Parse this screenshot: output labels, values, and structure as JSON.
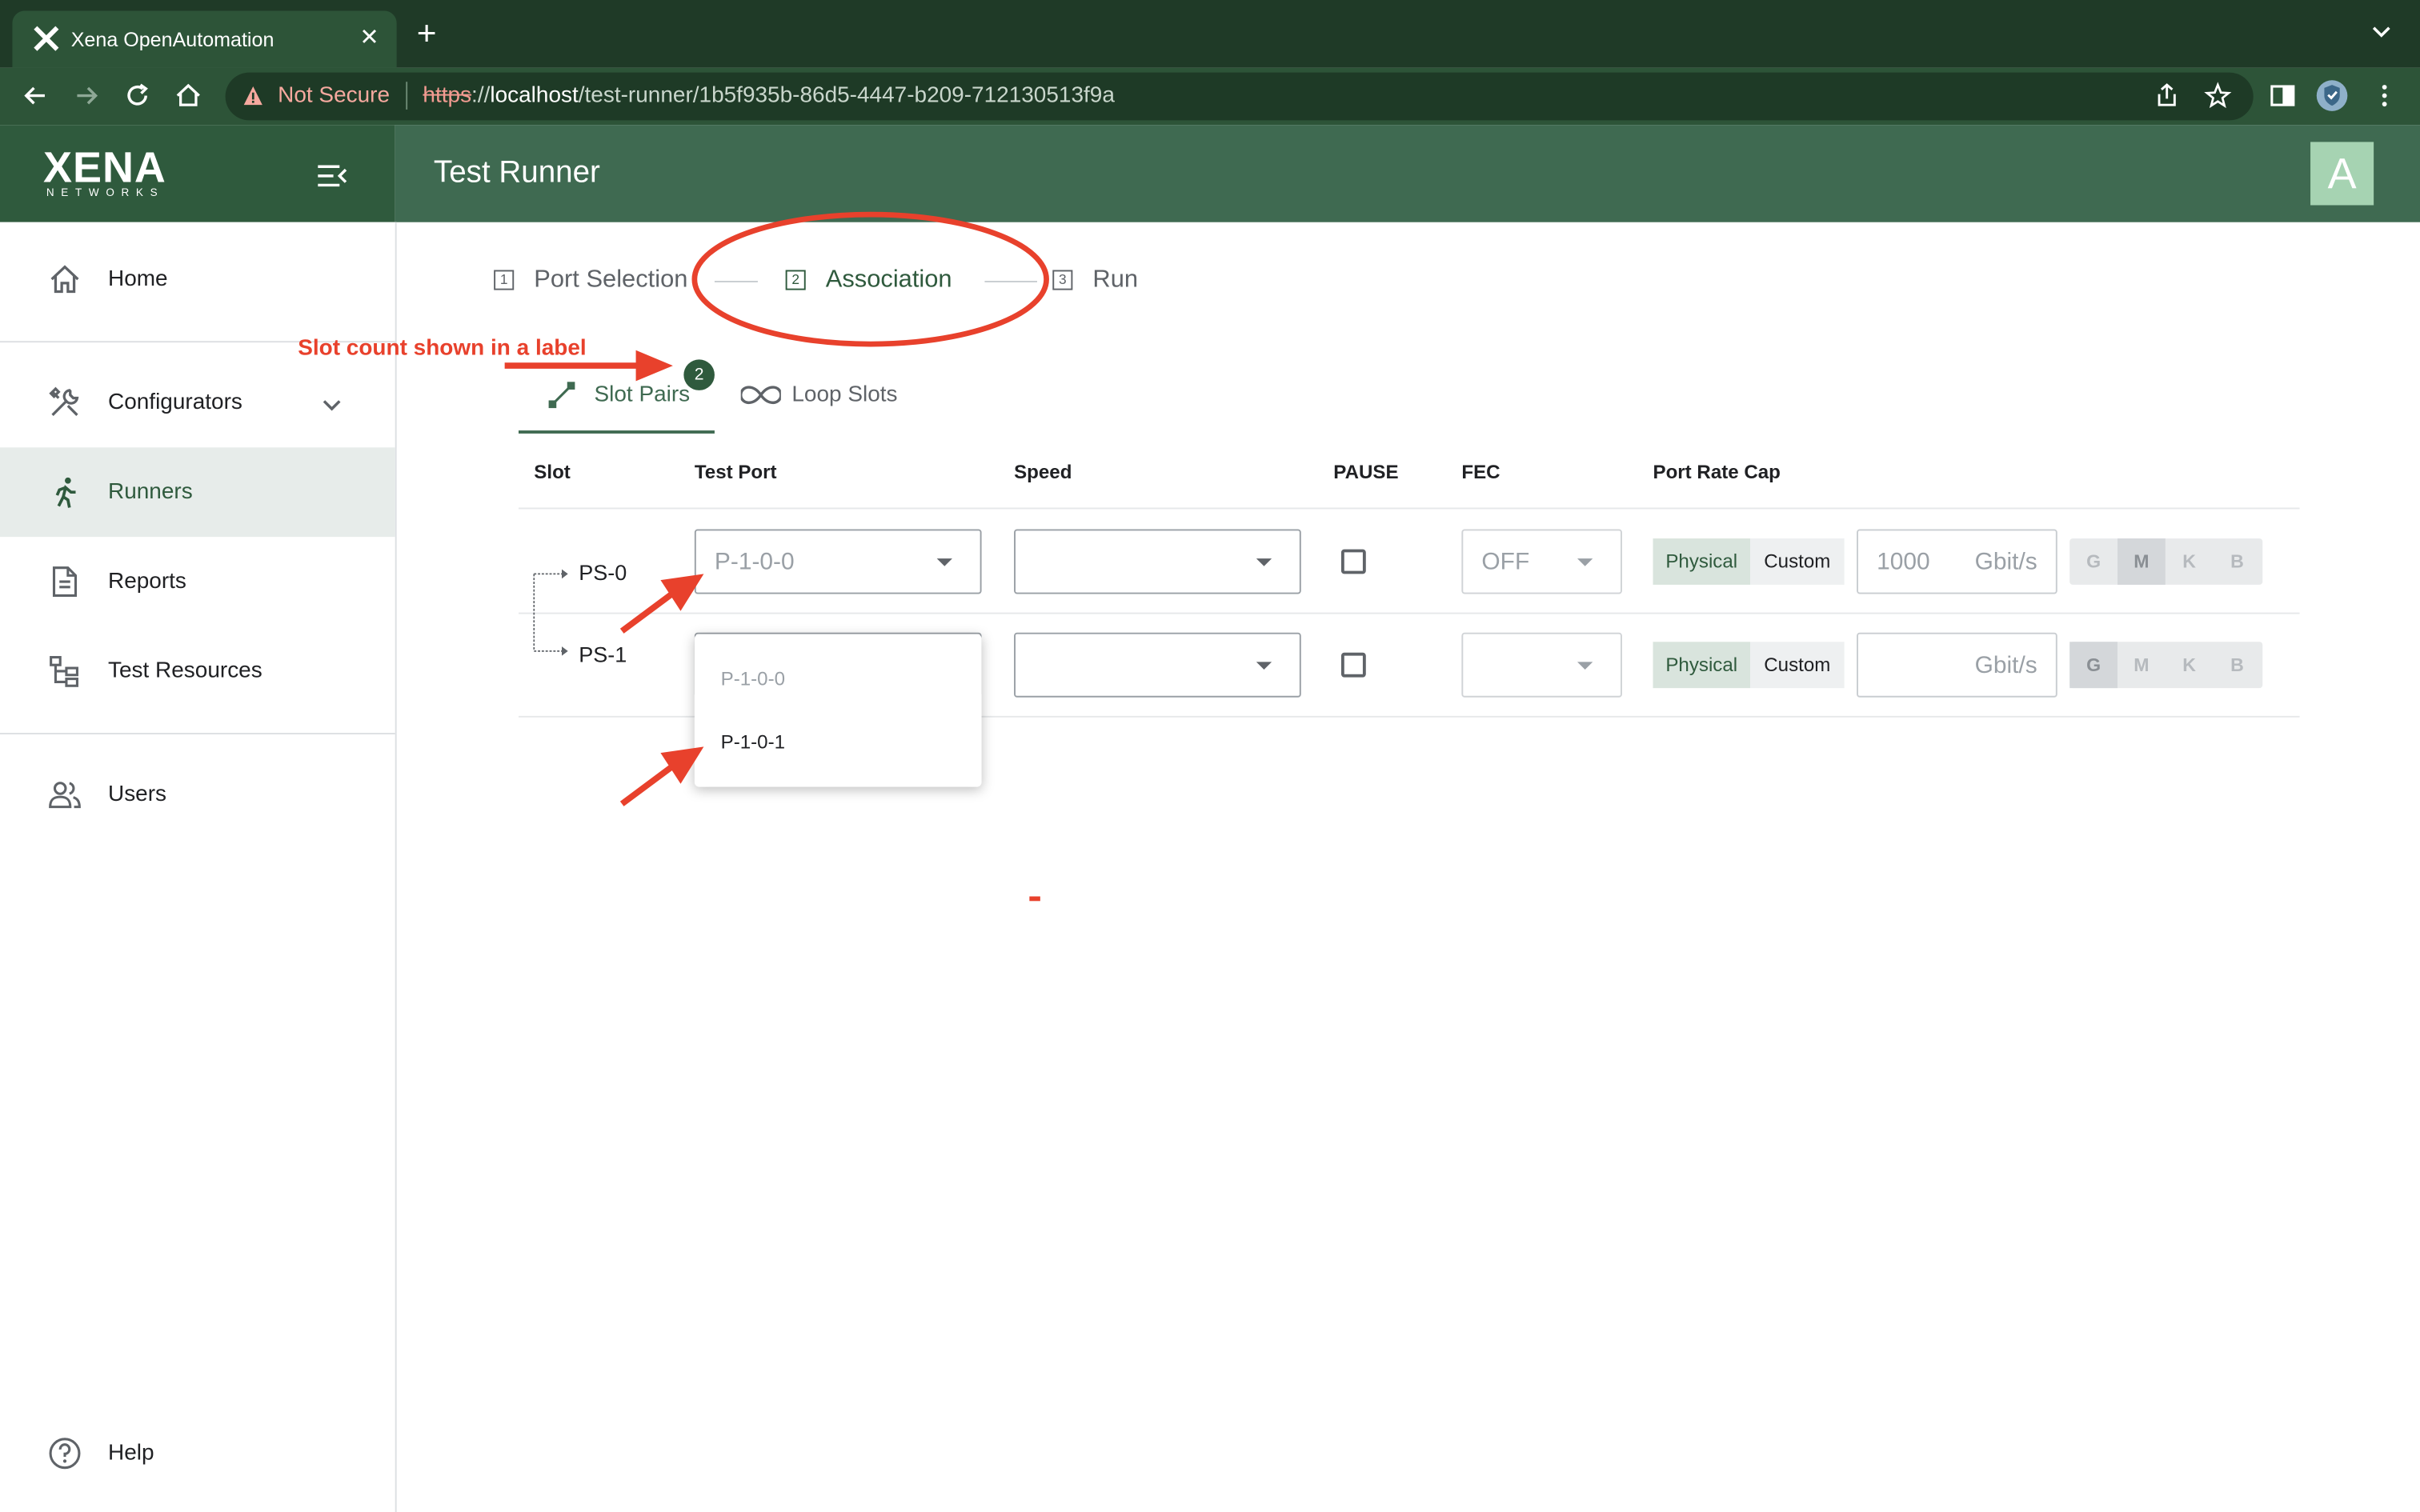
{
  "browser": {
    "tab_title": "Xena OpenAutomation",
    "tab_close": "✕",
    "new_tab": "+",
    "tab_menu": "⌄",
    "security_label": "Not Secure",
    "url_scheme": "https",
    "url_sep": "://",
    "url_host": "localhost",
    "url_path": "/test-runner/1b5f935b-86d5-4447-b209-712130513f9a"
  },
  "header": {
    "logo_text": "XENA",
    "logo_sub": "NETWORKS",
    "title": "Test Runner",
    "avatar": "A"
  },
  "sidebar": {
    "items": [
      {
        "label": "Home",
        "icon": "home-icon"
      },
      {
        "label": "Configurators",
        "icon": "tools-icon"
      },
      {
        "label": "Runners",
        "icon": "runner-icon"
      },
      {
        "label": "Reports",
        "icon": "document-icon"
      },
      {
        "label": "Test Resources",
        "icon": "tree-icon"
      },
      {
        "label": "Users",
        "icon": "users-icon"
      },
      {
        "label": "Help",
        "icon": "help-icon"
      }
    ]
  },
  "stepper": {
    "steps": [
      {
        "num": "1",
        "label": "Port Selection"
      },
      {
        "num": "2",
        "label": "Association"
      },
      {
        "num": "3",
        "label": "Run"
      }
    ]
  },
  "subtabs": {
    "slot_pairs": "Slot Pairs",
    "slot_count": "2",
    "loop_slots": "Loop Slots"
  },
  "table": {
    "headers": [
      "Slot",
      "Test Port",
      "Speed",
      "PAUSE",
      "FEC",
      "Port Rate Cap"
    ],
    "rows": [
      {
        "slot": "PS-0",
        "test_port": "P-1-0-0",
        "speed": "",
        "fec": "OFF",
        "cap_physical": "Physical",
        "cap_custom": "Custom",
        "rate": "1000",
        "rate_unit": "Gbit/s"
      },
      {
        "slot": "PS-1",
        "test_port": "",
        "speed": "",
        "fec": "",
        "cap_physical": "Physical",
        "cap_custom": "Custom",
        "rate": "",
        "rate_unit": "Gbit/s"
      }
    ],
    "units": [
      "G",
      "M",
      "K",
      "B"
    ]
  },
  "dropdown": {
    "options": [
      "P-1-0-0",
      "P-1-0-1"
    ]
  },
  "annotation": {
    "text": "Slot count shown in a label",
    "color": "#e8412c"
  },
  "colors": {
    "brand_dark": "#2f5a3d",
    "appbar": "#3f6a51",
    "browser_bg": "#1f3a27"
  }
}
